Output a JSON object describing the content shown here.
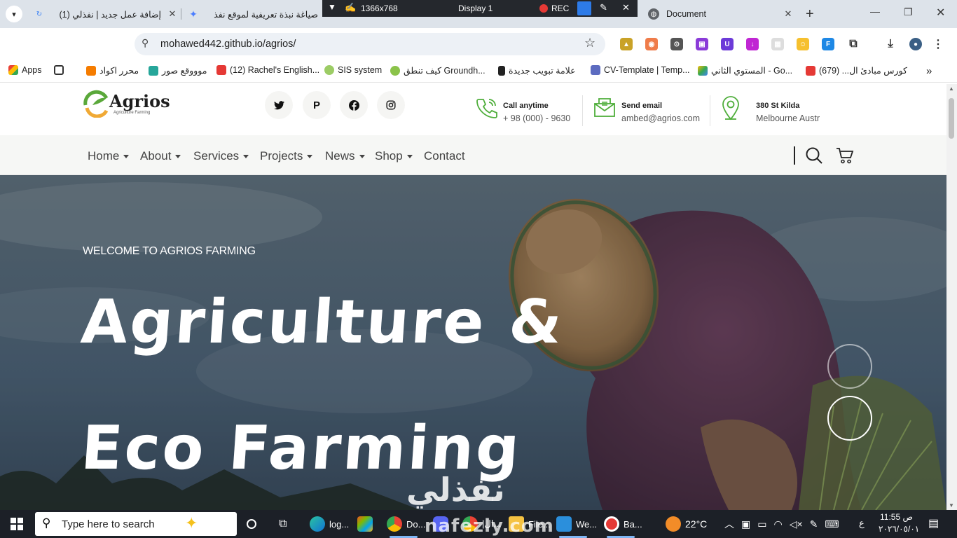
{
  "browser": {
    "tabs": [
      {
        "title": "(1) إضافة عمل جديد | نفذلي"
      },
      {
        "title": "صياغة نبذة تعريفية لموقع نفذ"
      },
      {
        "title": "Document"
      }
    ],
    "recorder": {
      "resolution": "1366x768",
      "display": "Display 1",
      "rec": "REC"
    },
    "url": "mohawed442.github.io/agrios/",
    "bookmarks": [
      "Apps",
      "محرر اكواد",
      "موووقع صور",
      "(12) Rachel's English...",
      "SIS system",
      "كيف تنطق Groundh...",
      "علامة تبويب جديدة",
      "CV-Template | Temp...",
      "المستوي الثاني - Go...",
      "كورس مبادئ ال... (679)"
    ]
  },
  "site": {
    "logo": {
      "name": "Agrios",
      "tagline": "Agriculture Farming"
    },
    "contact": [
      {
        "label": "Call anytime",
        "value": "+ 98 (000) - 9630"
      },
      {
        "label": "Send email",
        "value": "ambed@agrios.com"
      },
      {
        "label": "380 St Kilda",
        "value": "Melbourne Austr"
      }
    ],
    "menu": [
      {
        "label": "Home",
        "dropdown": true
      },
      {
        "label": "About",
        "dropdown": true
      },
      {
        "label": "Services",
        "dropdown": true
      },
      {
        "label": "Projects",
        "dropdown": true
      },
      {
        "label": "News",
        "dropdown": true
      },
      {
        "label": "Shop",
        "dropdown": true
      },
      {
        "label": "Contact",
        "dropdown": false
      }
    ],
    "hero": {
      "welcome": "WELCOME TO AGRIOS FARMING",
      "line1": "Agriculture &",
      "line2": "Eco Farming"
    }
  },
  "watermark": {
    "arabic": "نفذلي",
    "latin": "nafezly.com"
  },
  "taskbar": {
    "search_placeholder": "Type here to search",
    "apps": [
      "log...",
      "Do...",
      "|ال...",
      "File...",
      "We...",
      "Ba..."
    ],
    "weather": "22°C",
    "lang": "ع",
    "time": "11:55 ص",
    "date": "٢٠٢٦/٠٥/٠١"
  }
}
